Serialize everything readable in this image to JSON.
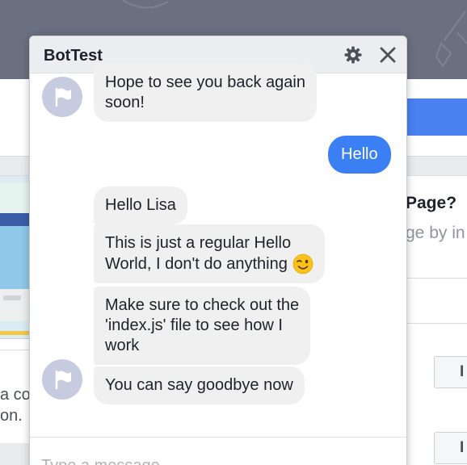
{
  "background": {
    "right_heading": "Page?",
    "right_subtext": "ge by in",
    "right_button_label": "I",
    "left_text_lines": [
      "a cov",
      "on."
    ]
  },
  "chat": {
    "title": "BotTest",
    "header_icons": [
      "gear-icon",
      "close-icon"
    ],
    "messages": [
      {
        "from": "bot",
        "text_lines": [
          "Hope to see you back again",
          "soon!"
        ]
      },
      {
        "from": "user",
        "text": "Hello"
      },
      {
        "from": "bot",
        "text": "Hello Lisa"
      },
      {
        "from": "bot",
        "text_lines": [
          "This is just a regular Hello",
          "World, I don't do anything"
        ],
        "emoji": "wink-emoji"
      },
      {
        "from": "bot",
        "text_lines": [
          "Make sure to check out the",
          "'index.js' file to see how I",
          "work"
        ]
      },
      {
        "from": "bot",
        "text": "You can say goodbye now"
      }
    ],
    "input_placeholder": "Type a message..."
  },
  "colors": {
    "accent": "#3a7ff3",
    "bot_bubble": "#f1f0f0",
    "avatar": "#c7cbdf",
    "header_bar": "#6a7080"
  }
}
